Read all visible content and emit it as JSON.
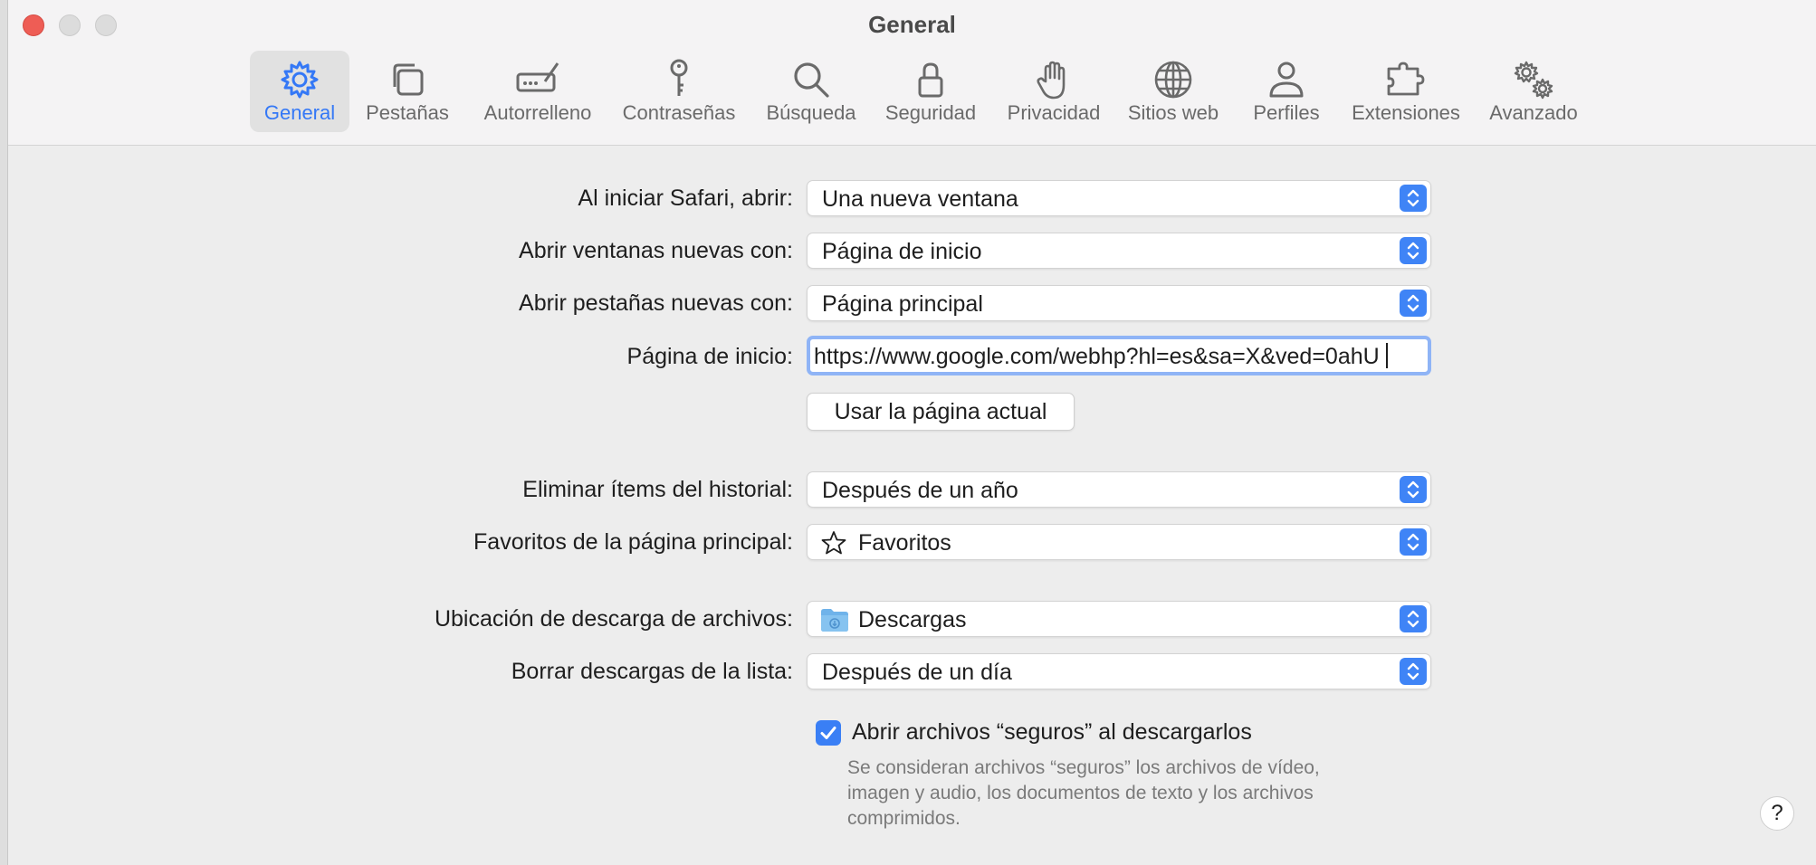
{
  "window": {
    "title": "General"
  },
  "toolbar": {
    "tabs": [
      {
        "label": "General",
        "icon": "gear-icon",
        "selected": true
      },
      {
        "label": "Pestañas",
        "icon": "tabs-icon"
      },
      {
        "label": "Autorrelleno",
        "icon": "autofill-icon"
      },
      {
        "label": "Contraseñas",
        "icon": "key-icon"
      },
      {
        "label": "Búsqueda",
        "icon": "search-icon"
      },
      {
        "label": "Seguridad",
        "icon": "lock-icon"
      },
      {
        "label": "Privacidad",
        "icon": "hand-icon"
      },
      {
        "label": "Sitios web",
        "icon": "globe-icon"
      },
      {
        "label": "Perfiles",
        "icon": "person-icon"
      },
      {
        "label": "Extensiones",
        "icon": "puzzle-icon"
      },
      {
        "label": "Avanzado",
        "icon": "gears-icon"
      }
    ]
  },
  "settings": {
    "open_with": {
      "label": "Al iniciar Safari, abrir:",
      "value": "Una nueva ventana"
    },
    "new_windows": {
      "label": "Abrir ventanas nuevas con:",
      "value": "Página de inicio"
    },
    "new_tabs": {
      "label": "Abrir pestañas nuevas con:",
      "value": "Página principal"
    },
    "homepage": {
      "label": "Página de inicio:",
      "value": "https://www.google.com/webhp?hl=es&sa=X&ved=0ahU"
    },
    "use_current_button": "Usar la página actual",
    "remove_history": {
      "label": "Eliminar ítems del historial:",
      "value": "Después de un año"
    },
    "favorites": {
      "label": "Favoritos de la página principal:",
      "value": "Favoritos"
    },
    "download_location": {
      "label": "Ubicación de descarga de archivos:",
      "value": "Descargas"
    },
    "clear_downloads": {
      "label": "Borrar descargas de la lista:",
      "value": "Después de un día"
    },
    "open_safe_files": {
      "label": "Abrir archivos “seguros” al descargarlos",
      "checked": true,
      "description": "Se consideran archivos “seguros” los archivos de vídeo, imagen y audio, los documentos de texto y los archivos comprimidos."
    }
  },
  "help_button": "?",
  "colors": {
    "accent": "#3478f6",
    "close": "#ee5d55"
  }
}
